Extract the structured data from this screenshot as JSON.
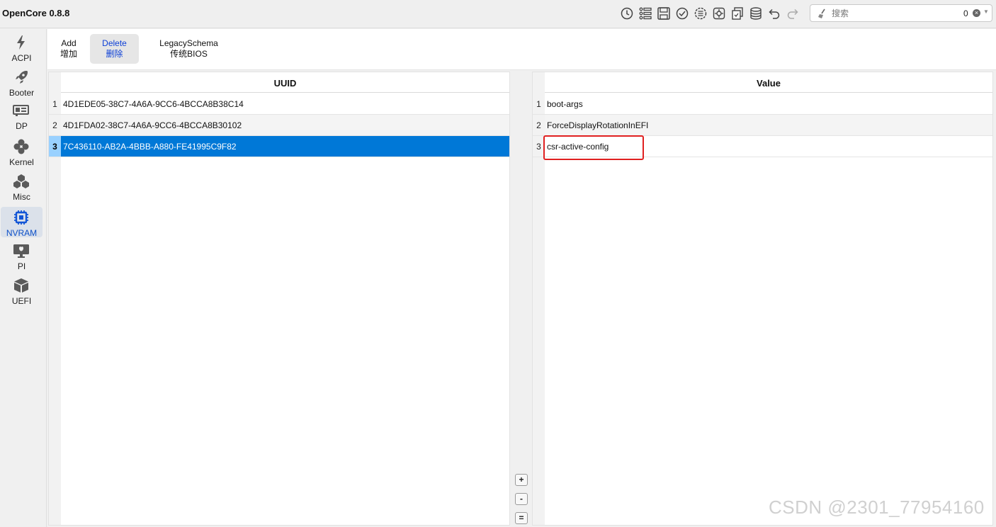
{
  "app": {
    "title": "OpenCore 0.8.8"
  },
  "toolbar_icons": [
    "history-icon",
    "list-icon",
    "save-icon",
    "check-icon",
    "list-circle-icon",
    "gear-icon",
    "copy-icon",
    "database-icon",
    "undo-icon",
    "redo-icon"
  ],
  "search": {
    "placeholder": "搜索",
    "count": "0"
  },
  "sidebar": {
    "items": [
      {
        "label": "ACPI",
        "icon": "bolt-icon"
      },
      {
        "label": "Booter",
        "icon": "rocket-icon"
      },
      {
        "label": "DP",
        "icon": "display-card-icon"
      },
      {
        "label": "Kernel",
        "icon": "atom-icon"
      },
      {
        "label": "Misc",
        "icon": "cubes-icon"
      },
      {
        "label": "NVRAM",
        "icon": "chip-icon",
        "active": true
      },
      {
        "label": "PI",
        "icon": "apple-monitor-icon"
      },
      {
        "label": "UEFI",
        "icon": "box-icon"
      }
    ]
  },
  "tabs": [
    {
      "label": "Add",
      "sub": "增加"
    },
    {
      "label": "Delete",
      "sub": "删除",
      "active": true
    },
    {
      "label": "LegacySchema",
      "sub": "传统BIOS"
    }
  ],
  "uuid_table": {
    "header": "UUID",
    "rows": [
      {
        "num": "1",
        "value": "4D1EDE05-38C7-4A6A-9CC6-4BCCA8B38C14"
      },
      {
        "num": "2",
        "value": "4D1FDA02-38C7-4A6A-9CC6-4BCCA8B30102"
      },
      {
        "num": "3",
        "value": "7C436110-AB2A-4BBB-A880-FE41995C9F82",
        "selected": true
      }
    ]
  },
  "value_table": {
    "header": "Value",
    "rows": [
      {
        "num": "1",
        "value": "boot-args"
      },
      {
        "num": "2",
        "value": "ForceDisplayRotationInEFI"
      },
      {
        "num": "3",
        "value": "csr-active-config"
      }
    ]
  },
  "mid_buttons": {
    "add": "+",
    "remove": "-",
    "equal": "="
  },
  "watermark": "CSDN @2301_77954160",
  "colors": {
    "selection": "#0078d7",
    "highlight_border": "#e02020",
    "active_tab_text": "#0c3fd6"
  }
}
